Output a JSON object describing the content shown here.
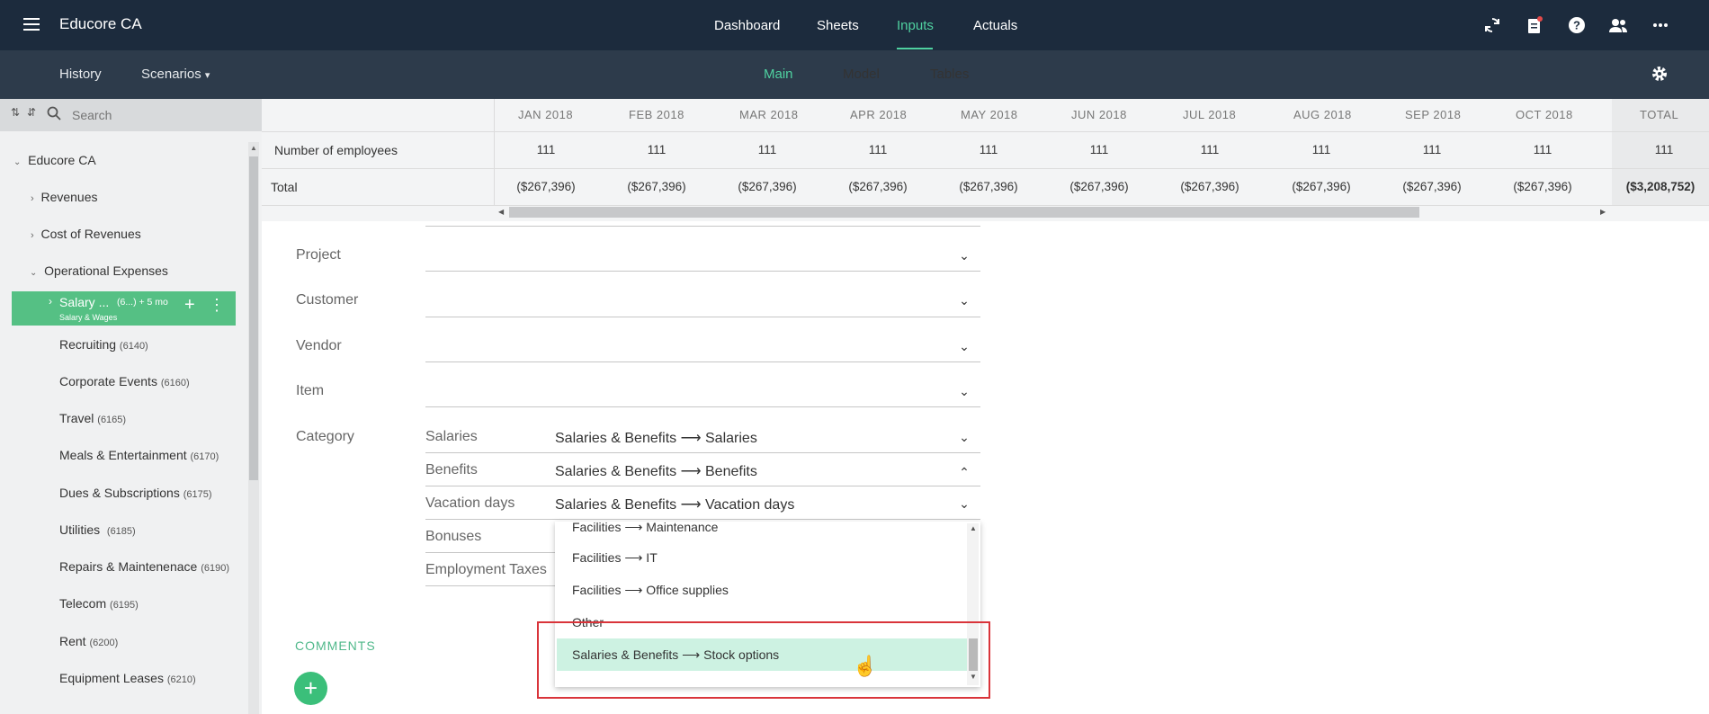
{
  "app": {
    "title": "Educore CA"
  },
  "topnav": {
    "items": [
      "Dashboard",
      "Sheets",
      "Inputs",
      "Actuals"
    ],
    "active": "Inputs"
  },
  "subnav": {
    "history": "History",
    "scenarios": "Scenarios",
    "tabs": [
      "Main",
      "Model",
      "Tables"
    ],
    "active_tab": "Main"
  },
  "sidebar": {
    "search_placeholder": "Search",
    "root": "Educore CA",
    "groups": [
      "Revenues",
      "Cost of Revenues",
      "Operational Expenses"
    ],
    "selected": {
      "label": "Salary ...",
      "code": "(6...) + 5 mo",
      "sublabel": "Salary & Wages"
    },
    "items": [
      {
        "label": "Recruiting",
        "code": "(6140)"
      },
      {
        "label": "Corporate Events",
        "code": "(6160)"
      },
      {
        "label": "Travel",
        "code": "(6165)"
      },
      {
        "label": "Meals & Entertainment",
        "code": "(6170)"
      },
      {
        "label": "Dues & Subscriptions",
        "code": "(6175)"
      },
      {
        "label": "Utilities",
        "code": "(6185)"
      },
      {
        "label": "Repairs & Maintenenace",
        "code": "(6190)"
      },
      {
        "label": "Telecom",
        "code": "(6195)"
      },
      {
        "label": "Rent",
        "code": "(6200)"
      },
      {
        "label": "Equipment Leases",
        "code": "(6210)"
      }
    ]
  },
  "grid": {
    "months": [
      "JAN 2018",
      "FEB 2018",
      "MAR 2018",
      "APR 2018",
      "MAY 2018",
      "JUN 2018",
      "JUL 2018",
      "AUG 2018",
      "SEP 2018",
      "OCT 2018"
    ],
    "total_header": "TOTAL",
    "rows": [
      {
        "label": "Number of employees",
        "value": "111",
        "total": "111"
      },
      {
        "label": "Total",
        "value": "($267,396)",
        "total": "($3,208,752)"
      }
    ]
  },
  "form": {
    "fields": [
      "Project",
      "Customer",
      "Vendor",
      "Item"
    ],
    "category_label": "Category",
    "categories": [
      {
        "name": "Salaries",
        "value": "Salaries & Benefits ⟶ Salaries"
      },
      {
        "name": "Benefits",
        "value": "Salaries & Benefits ⟶ Benefits"
      },
      {
        "name": "Vacation days",
        "value": "Salaries & Benefits ⟶ Vacation days"
      },
      {
        "name": "Bonuses",
        "value": ""
      },
      {
        "name": "Employment Taxes",
        "value": ""
      }
    ],
    "dropdown_options": [
      "Facilities ⟶ Maintenance",
      "Facilities ⟶ IT",
      "Facilities ⟶ Office supplies",
      "Other",
      "Salaries & Benefits ⟶ Stock options"
    ],
    "dropdown_selected": "Salaries & Benefits ⟶ Stock options"
  },
  "comments": {
    "title": "COMMENTS",
    "add": "+"
  },
  "colors": {
    "topbar": "#1c2b3d",
    "subbar": "#2d3b4b",
    "accent": "#4fd1a0",
    "selected": "#55c084",
    "highlight": "#cdf2e2",
    "redbox": "#d9343a"
  }
}
